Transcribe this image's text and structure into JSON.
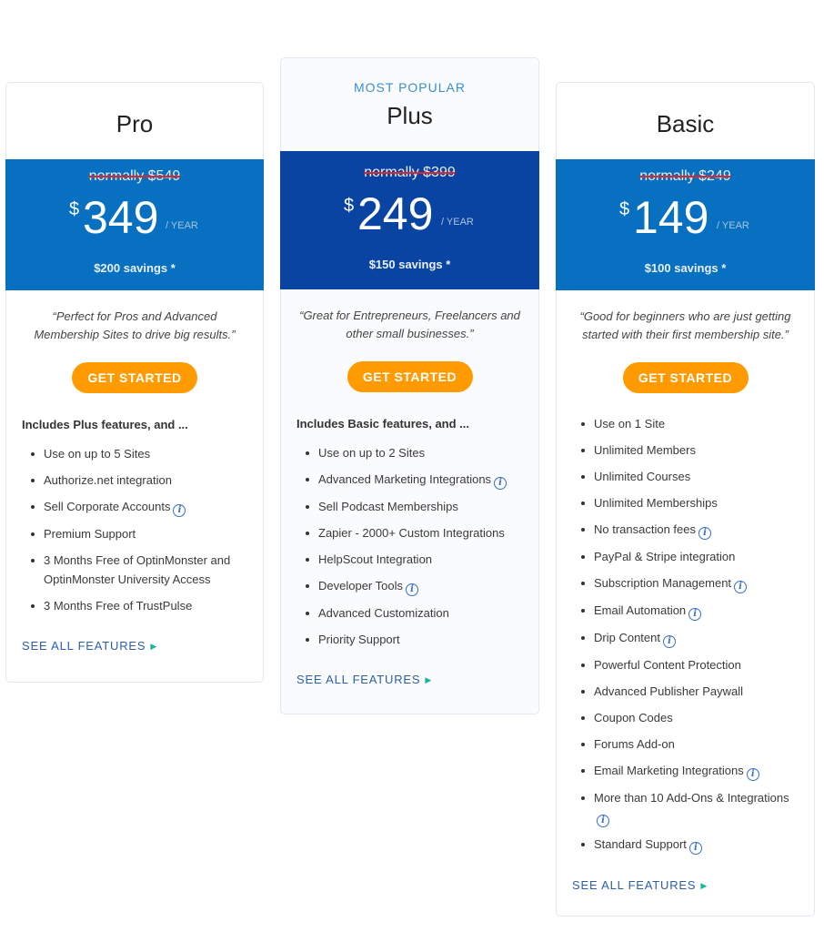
{
  "plans": [
    {
      "id": "pro",
      "badge": "",
      "name": "Pro",
      "normally": "normally $549",
      "currency": "$",
      "amount": "349",
      "period": "/ YEAR",
      "savings": "$200 savings *",
      "tagline": "“Perfect for Pros and Advanced Membership Sites to drive big results.”",
      "cta": "GET STARTED",
      "includes": "Includes Plus features, and ...",
      "features": [
        {
          "text": "Use on up to 5 Sites",
          "info": false
        },
        {
          "text": "Authorize.net integration",
          "info": false
        },
        {
          "text": "Sell Corporate Accounts",
          "info": true
        },
        {
          "text": "Premium Support",
          "info": false
        },
        {
          "text": "3 Months Free of OptinMonster and OptinMonster University Access",
          "info": false
        },
        {
          "text": "3 Months Free of TrustPulse",
          "info": false
        }
      ],
      "see_all": "SEE ALL FEATURES"
    },
    {
      "id": "plus",
      "badge": "MOST POPULAR",
      "name": "Plus",
      "normally": "normally $399",
      "currency": "$",
      "amount": "249",
      "period": "/ YEAR",
      "savings": "$150 savings *",
      "tagline": "“Great for Entrepreneurs, Freelancers and other small businesses.”",
      "cta": "GET STARTED",
      "includes": "Includes Basic features, and ...",
      "features": [
        {
          "text": "Use on up to 2 Sites",
          "info": false
        },
        {
          "text": "Advanced Marketing Integrations",
          "info": true
        },
        {
          "text": "Sell Podcast Memberships",
          "info": false
        },
        {
          "text": "Zapier - 2000+ Custom Integrations",
          "info": false
        },
        {
          "text": "HelpScout Integration",
          "info": false
        },
        {
          "text": "Developer Tools",
          "info": true
        },
        {
          "text": "Advanced Customization",
          "info": false
        },
        {
          "text": "Priority Support",
          "info": false
        }
      ],
      "see_all": "SEE ALL FEATURES"
    },
    {
      "id": "basic",
      "badge": "",
      "name": "Basic",
      "normally": "normally $249",
      "currency": "$",
      "amount": "149",
      "period": "/ YEAR",
      "savings": "$100 savings *",
      "tagline": "“Good for beginners who are just getting started with their first membership site.”",
      "cta": "GET STARTED",
      "includes": "",
      "features": [
        {
          "text": "Use on 1 Site",
          "info": false
        },
        {
          "text": "Unlimited Members",
          "info": false
        },
        {
          "text": "Unlimited Courses",
          "info": false
        },
        {
          "text": "Unlimited Memberships",
          "info": false
        },
        {
          "text": "No transaction fees",
          "info": true
        },
        {
          "text": "PayPal & Stripe integration",
          "info": false
        },
        {
          "text": "Subscription Management",
          "info": true
        },
        {
          "text": "Email Automation",
          "info": true
        },
        {
          "text": "Drip Content",
          "info": true
        },
        {
          "text": "Powerful Content Protection",
          "info": false
        },
        {
          "text": "Advanced Publisher Paywall",
          "info": false
        },
        {
          "text": "Coupon Codes",
          "info": false
        },
        {
          "text": "Forums Add-on",
          "info": false
        },
        {
          "text": "Email Marketing Integrations",
          "info": true
        },
        {
          "text": "More than 10 Add-Ons & Integrations",
          "info": true
        },
        {
          "text": "Standard Support",
          "info": true
        }
      ],
      "see_all": "SEE ALL FEATURES"
    }
  ],
  "icons": {
    "info": "i",
    "arrow": "▶"
  },
  "colors": {
    "price_standard": "#0870c0",
    "price_popular": "#0a44a2",
    "cta": "#ff9b00",
    "badge": "#3a8fd1",
    "link": "#2d5fa6",
    "arrow": "#18b3a0",
    "strike": "#e0242a"
  }
}
